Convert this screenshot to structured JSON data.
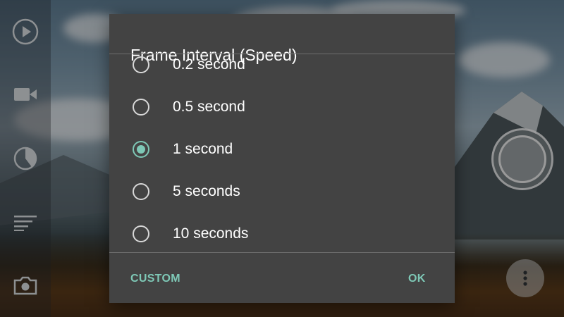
{
  "dialog": {
    "title": "Frame Interval (Speed)",
    "options": [
      {
        "label": "0.2 second",
        "selected": false
      },
      {
        "label": "0.5 second",
        "selected": false
      },
      {
        "label": "1 second",
        "selected": true
      },
      {
        "label": "5 seconds",
        "selected": false
      },
      {
        "label": "10 seconds",
        "selected": false
      }
    ],
    "custom_label": "CUSTOM",
    "ok_label": "OK"
  },
  "toolbar": {
    "items": [
      {
        "icon": "play-icon"
      },
      {
        "icon": "video-camera-icon"
      },
      {
        "icon": "pie-timer-icon"
      },
      {
        "icon": "list-lines-icon"
      },
      {
        "icon": "camera-icon"
      }
    ]
  },
  "controls": {
    "shutter_icon": "shutter-icon",
    "more_icon": "more-vertical-icon"
  },
  "colors": {
    "dialog_bg": "#434343",
    "accent": "#7ec8b6",
    "text": "#ffffff"
  }
}
